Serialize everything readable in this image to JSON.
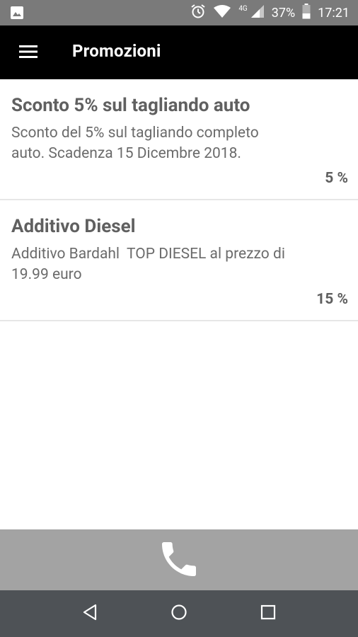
{
  "status_bar": {
    "network": "4G",
    "battery": "37%",
    "time": "17:21"
  },
  "app_bar": {
    "title": "Promozioni"
  },
  "promotions": [
    {
      "title": "Sconto 5% sul tagliando auto",
      "description": "Sconto del 5% sul tagliando completo\nauto. Scadenza 15 Dicembre 2018.",
      "discount": "5 %"
    },
    {
      "title": "Additivo Diesel",
      "description": "Additivo Bardahl  TOP DIESEL al prezzo di\n19.99 euro",
      "discount": "15 %"
    }
  ],
  "icons": {
    "status_left": "image-icon",
    "alarm": "alarm-icon",
    "wifi": "wifi-icon",
    "signal": "signal-icon",
    "battery": "battery-icon",
    "menu": "hamburger-menu-icon",
    "call": "phone-icon",
    "back": "back-icon",
    "home": "home-icon",
    "recents": "recents-icon"
  },
  "colors": {
    "status_bar": "#7a7a7a",
    "app_bar": "#000000",
    "call_bar": "#a3a3a3",
    "nav_bar": "#4e5256"
  }
}
